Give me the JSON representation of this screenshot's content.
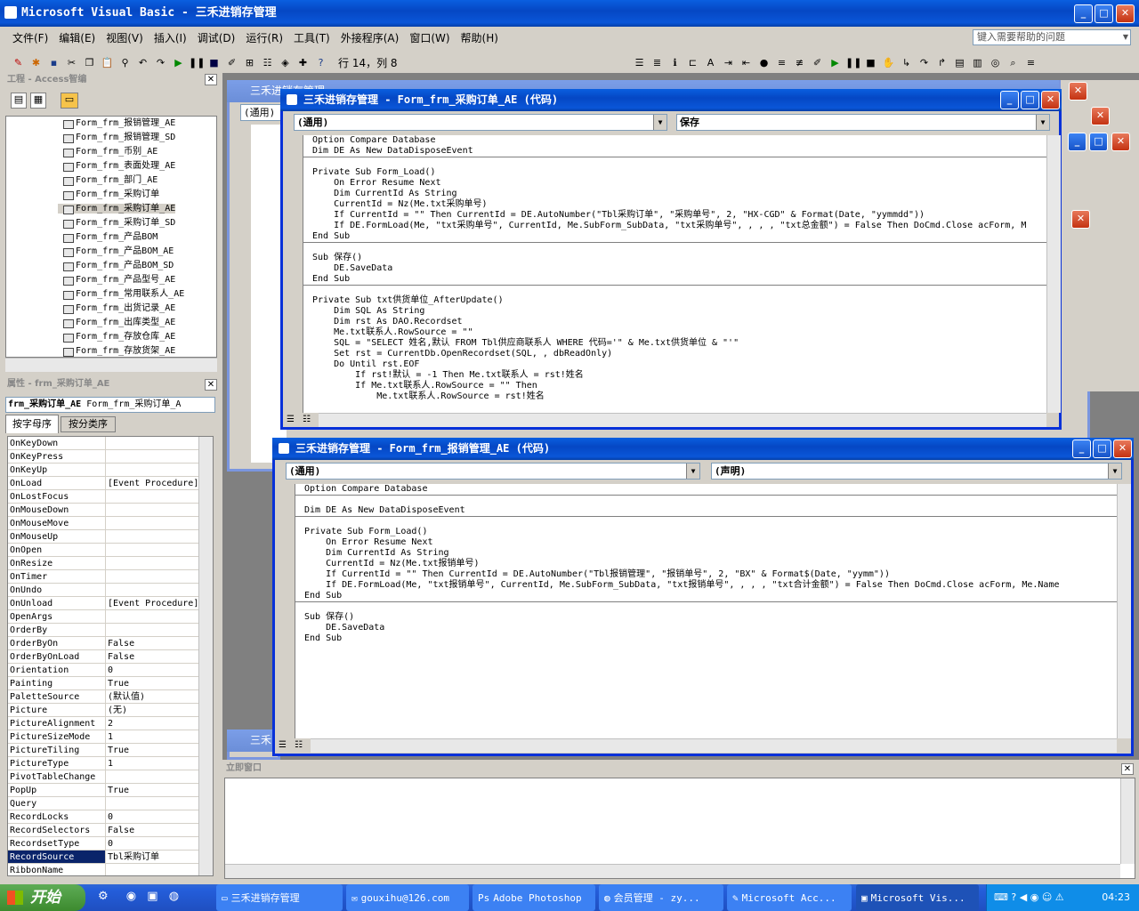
{
  "app": {
    "title": "Microsoft Visual Basic - 三禾进销存管理",
    "help_placeholder": "键入需要帮助的问题",
    "position": "行 14，列 8"
  },
  "menu": [
    "文件(F)",
    "编辑(E)",
    "视图(V)",
    "插入(I)",
    "调试(D)",
    "运行(R)",
    "工具(T)",
    "外接程序(A)",
    "窗口(W)",
    "帮助(H)"
  ],
  "project": {
    "title": "工程 - Access智编",
    "items": [
      "Form_frm_报销管理_AE",
      "Form_frm_报销管理_SD",
      "Form_frm_币别_AE",
      "Form_frm_表面处理_AE",
      "Form_frm_部门_AE",
      "Form_frm_采购订单",
      "Form_frm_采购订单_AE",
      "Form_frm_采购订单_SD",
      "Form_frm_产品BOM",
      "Form_frm_产品BOM_AE",
      "Form_frm_产品BOM_SD",
      "Form_frm_产品型号_AE",
      "Form_frm_常用联系人_AE",
      "Form_frm_出货记录_AE",
      "Form_frm_出库类型_AE",
      "Form_frm_存放仓库_AE",
      "Form_frm_存放货架_AE"
    ],
    "selected_index": 6
  },
  "properties": {
    "title": "属性 - frm_采购订单_AE",
    "object_name": "frm_采购订单_AE",
    "object_type": "Form_frm_采购订单_A",
    "tabs": [
      "按字母序",
      "按分类序"
    ],
    "rows": [
      [
        "OnKeyDown",
        ""
      ],
      [
        "OnKeyPress",
        ""
      ],
      [
        "OnKeyUp",
        ""
      ],
      [
        "OnLoad",
        "[Event Procedure]"
      ],
      [
        "OnLostFocus",
        ""
      ],
      [
        "OnMouseDown",
        ""
      ],
      [
        "OnMouseMove",
        ""
      ],
      [
        "OnMouseUp",
        ""
      ],
      [
        "OnOpen",
        ""
      ],
      [
        "OnResize",
        ""
      ],
      [
        "OnTimer",
        ""
      ],
      [
        "OnUndo",
        ""
      ],
      [
        "OnUnload",
        "[Event Procedure]"
      ],
      [
        "OpenArgs",
        ""
      ],
      [
        "OrderBy",
        ""
      ],
      [
        "OrderByOn",
        "False"
      ],
      [
        "OrderByOnLoad",
        "False"
      ],
      [
        "Orientation",
        "0"
      ],
      [
        "Painting",
        "True"
      ],
      [
        "PaletteSource",
        "(默认值)"
      ],
      [
        "Picture",
        "(无)"
      ],
      [
        "PictureAlignment",
        "2"
      ],
      [
        "PictureSizeMode",
        "1"
      ],
      [
        "PictureTiling",
        "True"
      ],
      [
        "PictureType",
        "1"
      ],
      [
        "PivotTableChange",
        ""
      ],
      [
        "PopUp",
        "True"
      ],
      [
        "Query",
        ""
      ],
      [
        "RecordLocks",
        "0"
      ],
      [
        "RecordSelectors",
        "False"
      ],
      [
        "RecordsetType",
        "0"
      ],
      [
        "RecordSource",
        "Tbl采购订单"
      ],
      [
        "RibbonName",
        ""
      ]
    ],
    "selected_index": 31
  },
  "code1": {
    "title": "三禾进销存管理 - Form_frm_采购订单_AE (代码)",
    "object": "(通用)",
    "proc": "保存",
    "lines": [
      "Option Compare Database",
      "Dim DE As New DataDisposeEvent",
      "---",
      "Private Sub Form_Load()",
      "    On Error Resume Next",
      "    Dim CurrentId As String",
      "    CurrentId = Nz(Me.txt采购单号)",
      "    If CurrentId = \"\" Then CurrentId = DE.AutoNumber(\"Tbl采购订单\", \"采购单号\", 2, \"HX-CGD\" & Format(Date, \"yymmdd\"))",
      "    If DE.FormLoad(Me, \"txt采购单号\", CurrentId, Me.SubForm_SubData, \"txt采购单号\", , , , \"txt总金额\") = False Then DoCmd.Close acForm, M",
      "End Sub",
      "---",
      "Sub 保存()",
      "    DE.SaveData",
      "End Sub",
      "---",
      "Private Sub txt供货单位_AfterUpdate()",
      "    Dim SQL As String",
      "    Dim rst As DAO.Recordset",
      "    Me.txt联系人.RowSource = \"\"",
      "    SQL = \"SELECT 姓名,默认 FROM Tbl供应商联系人 WHERE 代码='\" & Me.txt供货单位 & \"'\"",
      "    Set rst = CurrentDb.OpenRecordset(SQL, , dbReadOnly)",
      "    Do Until rst.EOF",
      "        If rst!默认 = -1 Then Me.txt联系人 = rst!姓名",
      "        If Me.txt联系人.RowSource = \"\" Then",
      "            Me.txt联系人.RowSource = rst!姓名"
    ]
  },
  "code2": {
    "title": "三禾进销存管理 - Form_frm_报销管理_AE (代码)",
    "object": "(通用)",
    "proc": "(声明)",
    "lines": [
      "Option Compare Database",
      "---",
      "Dim DE As New DataDisposeEvent",
      "---",
      "Private Sub Form_Load()",
      "    On Error Resume Next",
      "    Dim CurrentId As String",
      "    CurrentId = Nz(Me.txt报销单号)",
      "    If CurrentId = \"\" Then CurrentId = DE.AutoNumber(\"Tbl报销管理\", \"报销单号\", 2, \"BX\" & Format$(Date, \"yymm\"))",
      "    If DE.FormLoad(Me, \"txt报销单号\", CurrentId, Me.SubForm_SubData, \"txt报销单号\", , , , \"txt合计金额\") = False Then DoCmd.Close acForm, Me.Name",
      "End Sub",
      "---",
      "Sub 保存()",
      "    DE.SaveData",
      "End Sub"
    ]
  },
  "bg": {
    "title1": "三禾进销存管理",
    "general": "(通用)",
    "title2": "三禾"
  },
  "immediate": {
    "title": "立即窗口"
  },
  "taskbar": {
    "start": "开始",
    "tasks": [
      "三禾进销存管理",
      "gouxihu@126.com",
      "Adobe Photoshop",
      "会员管理 - zy...",
      "Microsoft Acc...",
      "Microsoft Vis..."
    ],
    "active_index": 5,
    "clock": "04:23"
  },
  "colors": {
    "titlebar": "#0a56d8",
    "accent": "#0831d9",
    "selection": "#0a246a",
    "taskbar": "#245edb",
    "start": "#3c8a2e"
  }
}
